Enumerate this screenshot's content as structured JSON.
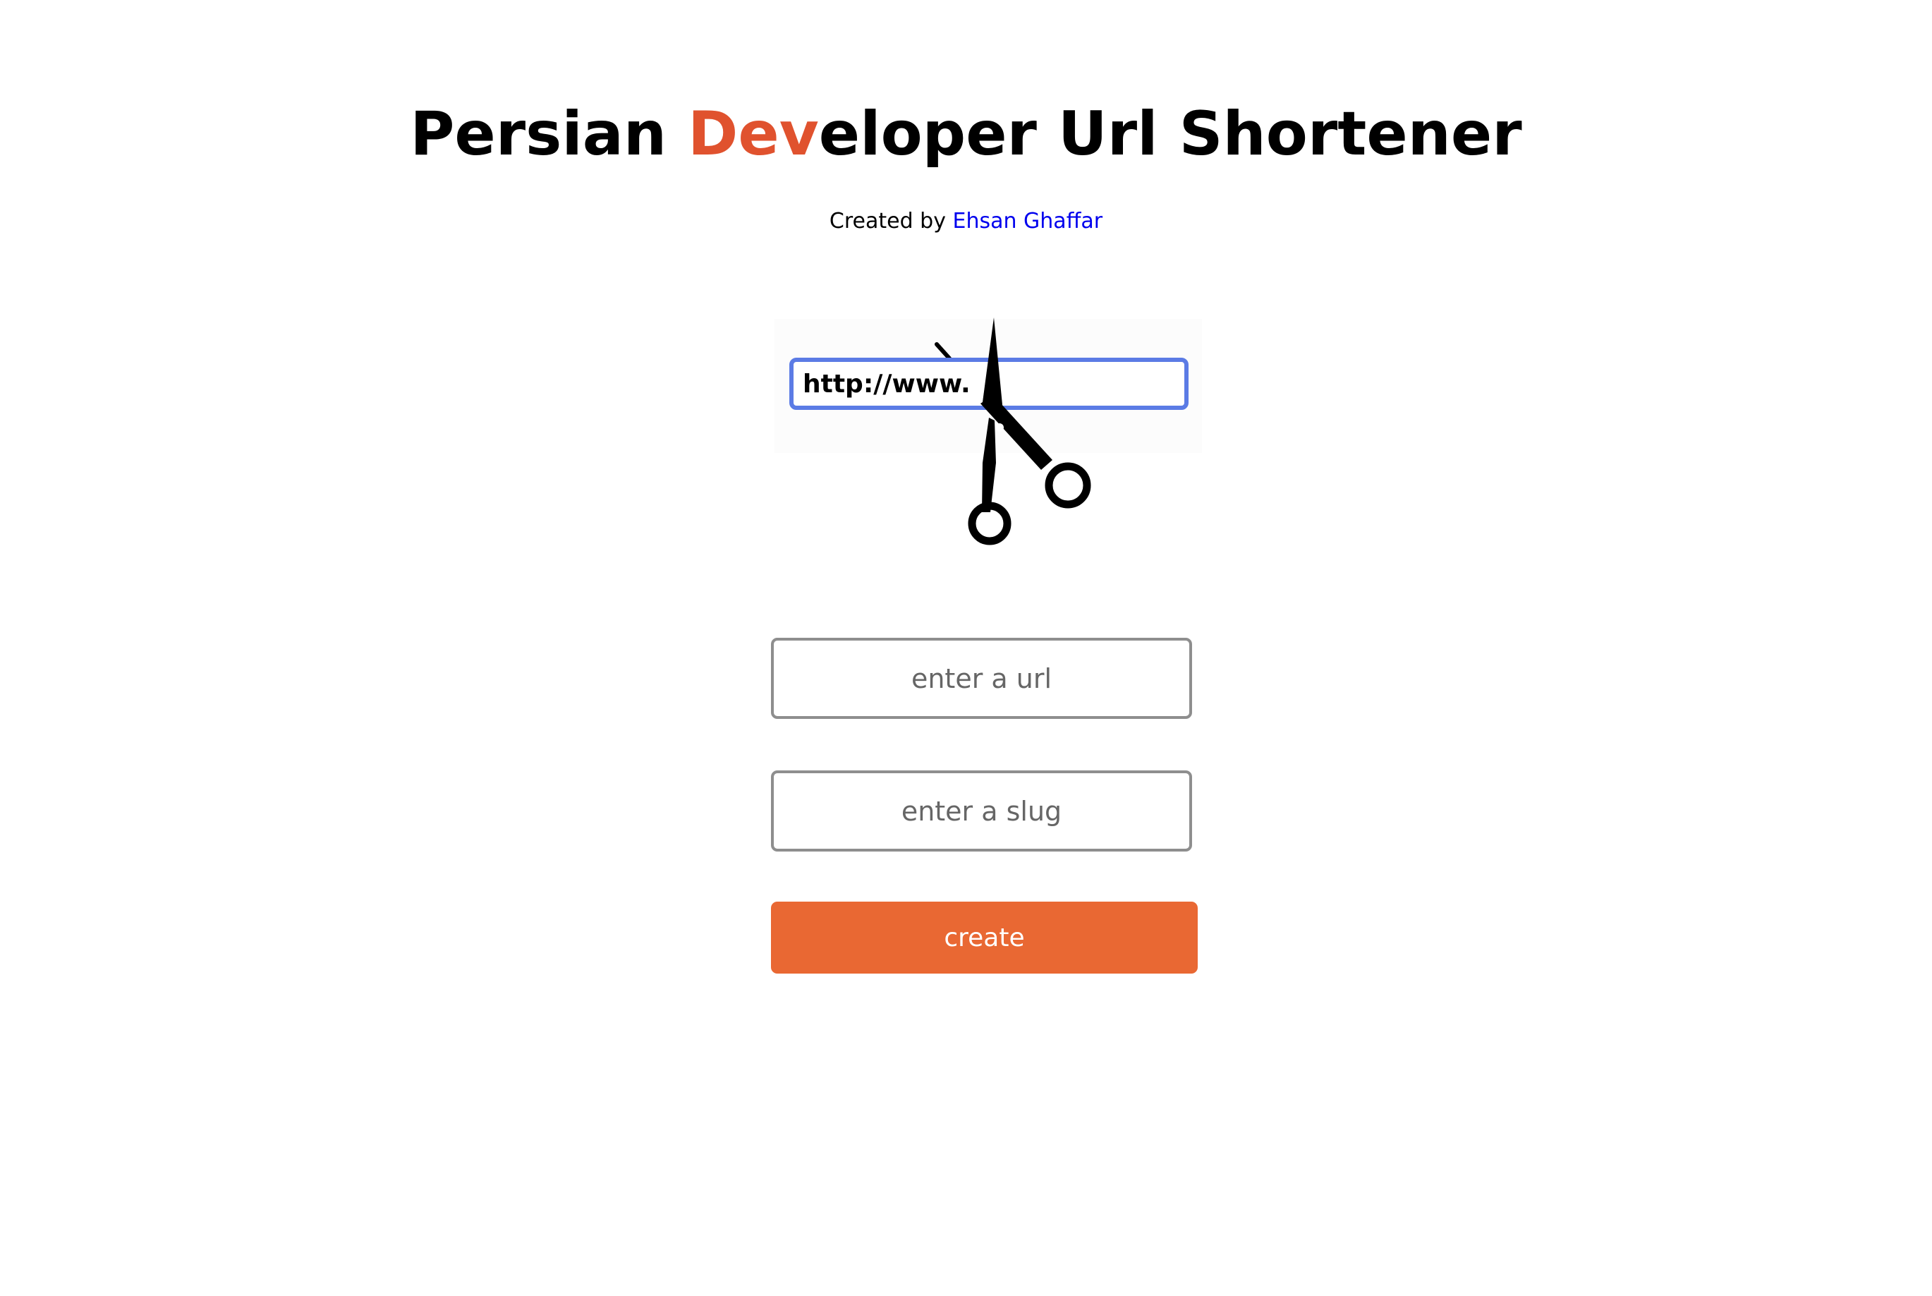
{
  "header": {
    "title_prefix": "Persian ",
    "title_accent": "Dev",
    "title_suffix": "eloper Url Shortener",
    "accent_color": "#e0522e"
  },
  "credit": {
    "prefix": "Created by ",
    "author": "Ehsan Ghaffar",
    "link_color": "#0000ee"
  },
  "logo": {
    "box_text": "http://www.",
    "icon": "scissors-icon",
    "box_border_color": "#5b7be5"
  },
  "form": {
    "url_placeholder": "enter a url",
    "url_value": "",
    "slug_placeholder": "enter a slug",
    "slug_value": "",
    "submit_label": "create",
    "button_color": "#e96833"
  }
}
